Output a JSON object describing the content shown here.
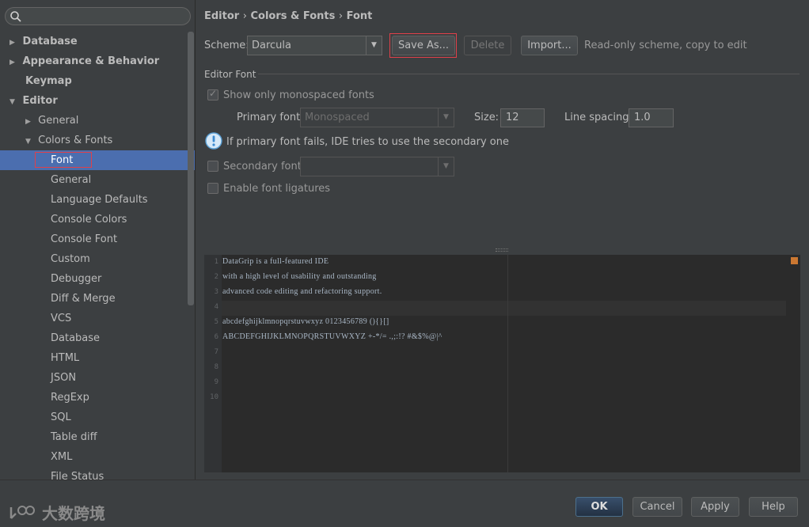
{
  "search": {
    "placeholder": ""
  },
  "sidebar": {
    "items": [
      {
        "label": "Database",
        "arrow": "▶"
      },
      {
        "label": "Appearance & Behavior",
        "arrow": "▶"
      },
      {
        "label": "Keymap",
        "arrow": ""
      },
      {
        "label": "Editor",
        "arrow": "▼"
      },
      {
        "label": "General",
        "arrow": "▶"
      },
      {
        "label": "Colors & Fonts",
        "arrow": "▼"
      },
      {
        "label": "Font"
      },
      {
        "label": "General"
      },
      {
        "label": "Language Defaults"
      },
      {
        "label": "Console Colors"
      },
      {
        "label": "Console Font"
      },
      {
        "label": "Custom"
      },
      {
        "label": "Debugger"
      },
      {
        "label": "Diff & Merge"
      },
      {
        "label": "VCS"
      },
      {
        "label": "Database"
      },
      {
        "label": "HTML"
      },
      {
        "label": "JSON"
      },
      {
        "label": "RegExp"
      },
      {
        "label": "SQL"
      },
      {
        "label": "Table diff"
      },
      {
        "label": "XML"
      },
      {
        "label": "File Status"
      }
    ]
  },
  "breadcrumb": {
    "part1": "Editor",
    "sep1": "›",
    "part2": "Colors & Fonts",
    "sep2": "›",
    "part3": "Font"
  },
  "scheme": {
    "label": "Scheme:",
    "value": "Darcula",
    "save_as": "Save As...",
    "delete": "Delete",
    "import": "Import...",
    "note": "Read-only scheme, copy to edit"
  },
  "editor_font": {
    "section_title": "Editor Font",
    "show_mono_label": "Show only monospaced fonts",
    "primary_label": "Primary font:",
    "primary_value": "Monospaced",
    "size_label": "Size:",
    "size_value": "12",
    "spacing_label": "Line spacing:",
    "spacing_value": "1.0",
    "info_text": "If primary font fails, IDE tries to use the secondary one",
    "secondary_label": "Secondary font:",
    "secondary_value": "",
    "ligatures_label": "Enable font ligatures"
  },
  "preview": {
    "line_numbers": [
      "1",
      "2",
      "3",
      "4",
      "5",
      "6",
      "7",
      "8",
      "9",
      "10"
    ],
    "lines": [
      "DataGrip is a full-featured IDE",
      "with a high level of usability and outstanding",
      "advanced code editing and refactoring support.",
      "",
      "abcdefghijklmnopqrstuvwxyz 0123456789 (){}[]",
      "ABCDEFGHIJKLMNOPQRSTUVWXYZ +-*/= .,;:!? #&$%@|^"
    ]
  },
  "footer": {
    "ok": "OK",
    "cancel": "Cancel",
    "apply": "Apply",
    "help": "Help",
    "watermark": "大数跨境"
  },
  "colors": {
    "selection": "#4b6eaf",
    "highlight_box": "#e0404a",
    "marker": "#cc7832"
  }
}
